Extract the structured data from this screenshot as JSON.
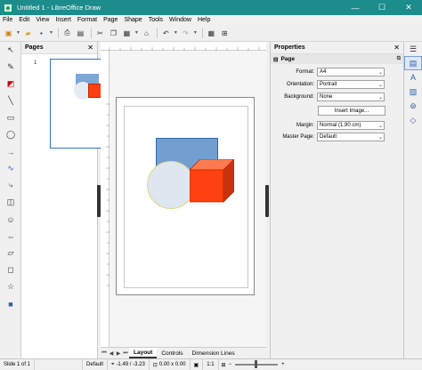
{
  "window": {
    "title": "Untitled 1 - LibreOffice Draw",
    "buttons": {
      "minimize": "—",
      "maximize": "☐",
      "close": "✕"
    }
  },
  "menu": [
    "File",
    "Edit",
    "View",
    "Insert",
    "Format",
    "Page",
    "Shape",
    "Tools",
    "Window",
    "Help"
  ],
  "pages_pane": {
    "title": "Pages",
    "thumbnail_number": "1"
  },
  "properties": {
    "title": "Properties",
    "section": "Page",
    "rows": {
      "format": {
        "label": "Format:",
        "value": "A4"
      },
      "orientation": {
        "label": "Orientation:",
        "value": "Portrait"
      },
      "background": {
        "label": "Background:",
        "value": "None"
      },
      "margin": {
        "label": "Margin:",
        "value": "Normal (1.90 cm)"
      },
      "master_page": {
        "label": "Master Page:",
        "value": "Default"
      }
    },
    "insert_image_label": "Insert Image..."
  },
  "tabs": [
    "Layout",
    "Controls",
    "Dimension Lines"
  ],
  "status": {
    "slide": "Slide 1 of 1",
    "master": "Default",
    "position": "-1.49 / -3.23",
    "size": "0.00 x 0.00",
    "scale": "1:1"
  },
  "colors": {
    "titlebar": "#1d8c8c",
    "rect_fill": "#729fcf",
    "circle_fill": "#dee6ef",
    "cube_fill": "#ff4010"
  }
}
